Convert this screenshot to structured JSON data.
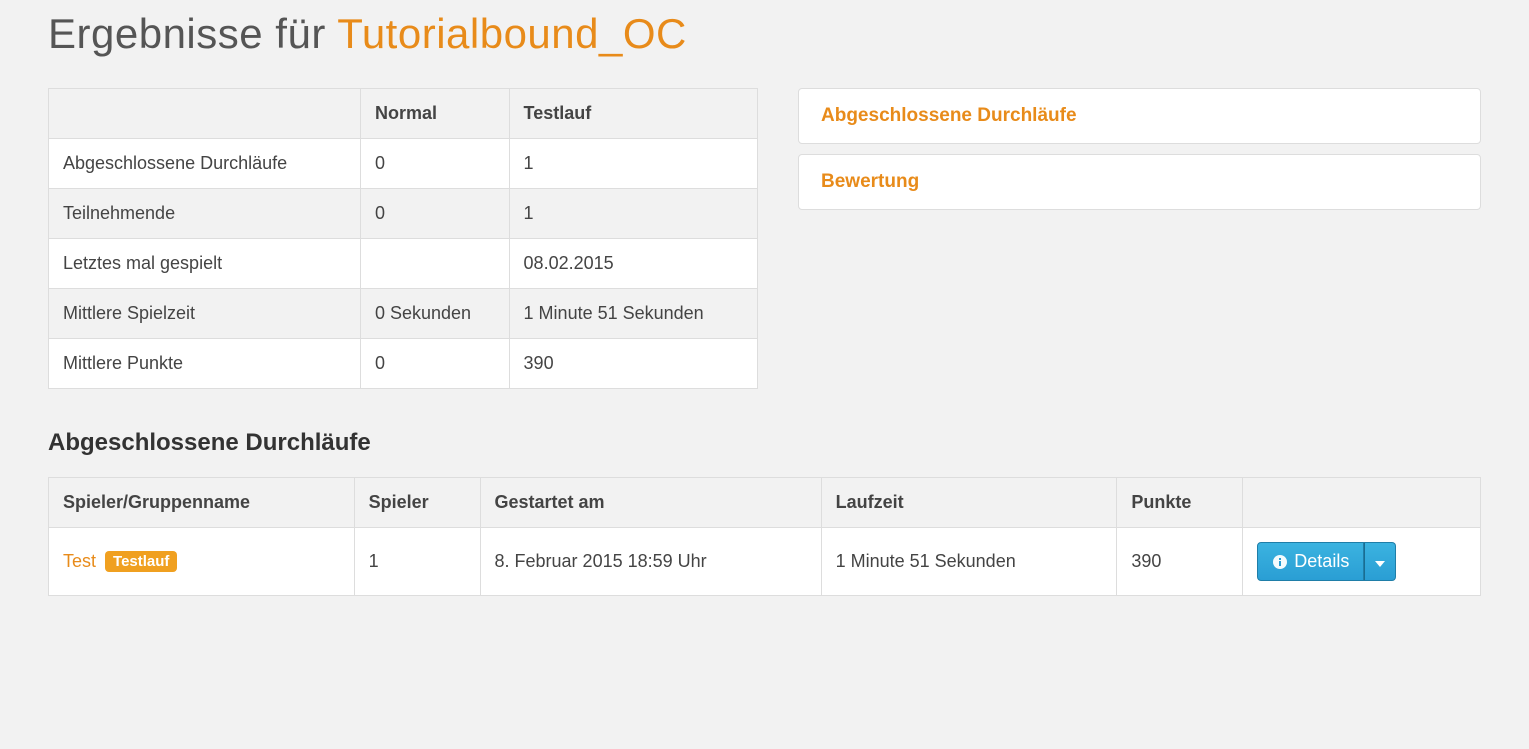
{
  "header": {
    "title_prefix": "Ergebnisse für ",
    "title_accent": "Tutorialbound_OC"
  },
  "stats_table": {
    "headers": {
      "empty": "",
      "normal": "Normal",
      "testlauf": "Testlauf"
    },
    "rows": [
      {
        "label": "Abgeschlossene Durchläufe",
        "normal": "0",
        "testlauf": "1"
      },
      {
        "label": "Teilnehmende",
        "normal": "0",
        "testlauf": "1"
      },
      {
        "label": "Letztes mal gespielt",
        "normal": "",
        "testlauf": "08.02.2015"
      },
      {
        "label": "Mittlere Spielzeit",
        "normal": "0 Sekunden",
        "testlauf": "1 Minute 51 Sekunden"
      },
      {
        "label": "Mittlere Punkte",
        "normal": "0",
        "testlauf": "390"
      }
    ]
  },
  "sidebar": {
    "items": [
      {
        "label": "Abgeschlossene Durchläufe"
      },
      {
        "label": "Bewertung"
      }
    ]
  },
  "section": {
    "heading": "Abgeschlossene Durchläufe"
  },
  "runs_table": {
    "headers": {
      "player_group": "Spieler/Gruppenname",
      "players": "Spieler",
      "started": "Gestartet am",
      "runtime": "Laufzeit",
      "points": "Punkte",
      "actions": ""
    },
    "rows": [
      {
        "name": "Test",
        "badge": "Testlauf",
        "players": "1",
        "started": "8. Februar 2015 18:59 Uhr",
        "runtime": "1 Minute 51 Sekunden",
        "points": "390"
      }
    ],
    "details_label": "Details"
  }
}
